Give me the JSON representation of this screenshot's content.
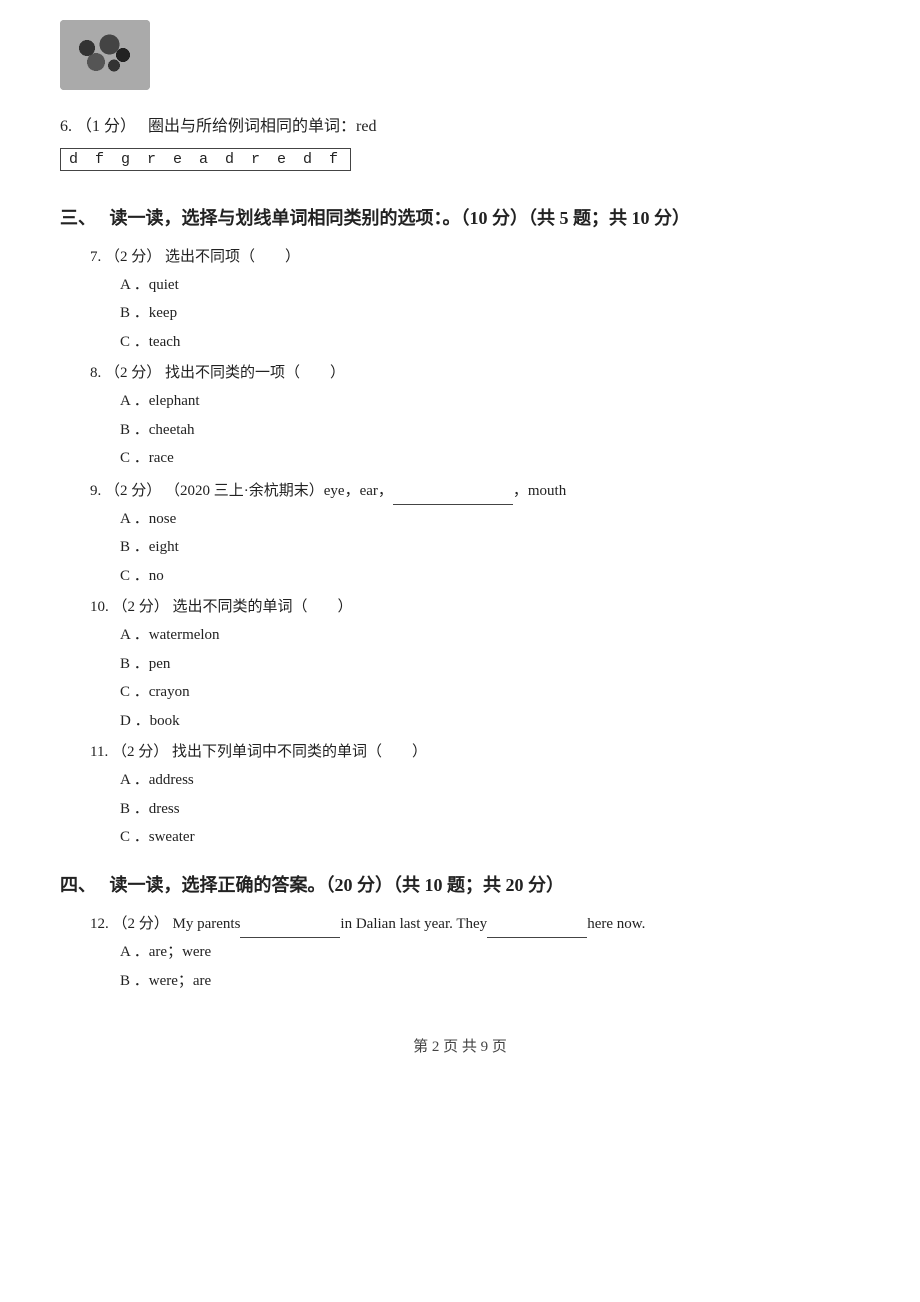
{
  "image": {
    "alt": "sketch image"
  },
  "q6": {
    "number": "6.",
    "score": "（1 分）",
    "instruction": "圈出与所给例词相同的单词：red",
    "word_box": "d f g r e a d r e d f"
  },
  "section3": {
    "label": "三、",
    "title": "读一读，选择与划线单词相同类别的选项：。（10 分）（共 5 题；共 10 分）"
  },
  "questions": [
    {
      "number": "7.",
      "score": "（2 分）",
      "text": "选出不同项（　　）",
      "options": [
        {
          "letter": "A",
          "text": "quiet"
        },
        {
          "letter": "B",
          "text": "keep"
        },
        {
          "letter": "C",
          "text": "teach"
        }
      ]
    },
    {
      "number": "8.",
      "score": "（2 分）",
      "text": "找出不同类的一项（　　）",
      "options": [
        {
          "letter": "A",
          "text": "elephant"
        },
        {
          "letter": "B",
          "text": "cheetah"
        },
        {
          "letter": "C",
          "text": "race"
        }
      ]
    },
    {
      "number": "9.",
      "score": "（2 分）",
      "text": "（2020 三上·余杭期末）eye，ear，____________，mouth",
      "options": [
        {
          "letter": "A",
          "text": "nose"
        },
        {
          "letter": "B",
          "text": "eight"
        },
        {
          "letter": "C",
          "text": "no"
        }
      ]
    },
    {
      "number": "10.",
      "score": "（2 分）",
      "text": "选出不同类的单词（　　）",
      "options": [
        {
          "letter": "A",
          "text": "watermelon"
        },
        {
          "letter": "B",
          "text": "pen"
        },
        {
          "letter": "C",
          "text": "crayon"
        },
        {
          "letter": "D",
          "text": "book"
        }
      ]
    },
    {
      "number": "11.",
      "score": "（2 分）",
      "text": "找出下列单词中不同类的单词（　　）",
      "options": [
        {
          "letter": "A",
          "text": "address"
        },
        {
          "letter": "B",
          "text": "dress"
        },
        {
          "letter": "C",
          "text": "sweater"
        }
      ]
    }
  ],
  "section4": {
    "label": "四、",
    "title": "读一读，选择正确的答案。（20 分）（共 10 题；共 20 分）"
  },
  "questions2": [
    {
      "number": "12.",
      "score": "（2 分）",
      "text_parts": [
        "My parents",
        "in Dalian last year. They",
        "here now."
      ],
      "options": [
        {
          "letter": "A",
          "text": "are；were"
        },
        {
          "letter": "B",
          "text": "were；are"
        }
      ]
    }
  ],
  "footer": {
    "text": "第 2 页 共 9 页"
  }
}
